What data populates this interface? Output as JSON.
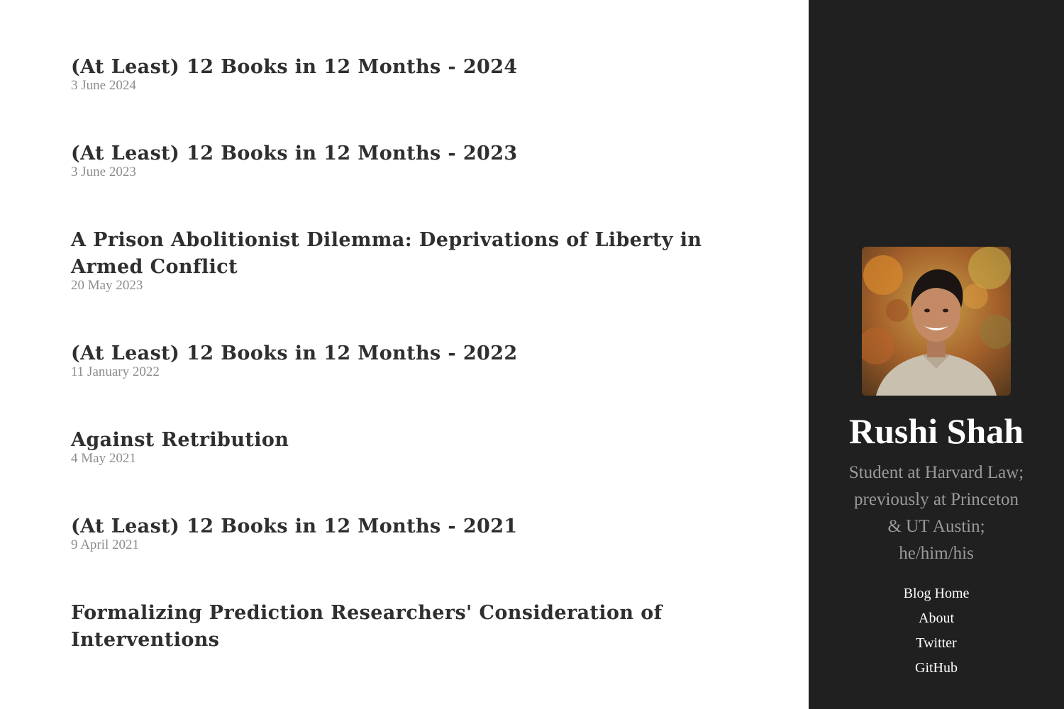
{
  "posts": [
    {
      "title": "(At Least) 12 Books in 12 Months - 2024",
      "date": "3 June 2024"
    },
    {
      "title": "(At Least) 12 Books in 12 Months - 2023",
      "date": "3 June 2023"
    },
    {
      "title": "A Prison Abolitionist Dilemma: Deprivations of Liberty in Armed Conflict",
      "date": "20 May 2023"
    },
    {
      "title": "(At Least) 12 Books in 12 Months - 2022",
      "date": "11 January 2022"
    },
    {
      "title": "Against Retribution",
      "date": "4 May 2021"
    },
    {
      "title": "(At Least) 12 Books in 12 Months - 2021",
      "date": "9 April 2021"
    },
    {
      "title": "Formalizing Prediction Researchers' Consideration of Interventions",
      "date": ""
    }
  ],
  "sidebar": {
    "name": "Rushi Shah",
    "bio_lines": [
      "Student at Harvard Law;",
      "previously at Princeton",
      "& UT Austin;",
      "he/him/his"
    ],
    "avatar_icon": "profile-photo",
    "nav": {
      "blog_home": "Blog Home",
      "about": "About",
      "twitter": "Twitter",
      "github": "GitHub"
    }
  },
  "colors": {
    "sidebar_bg": "#202020",
    "title": "#2f2f2f",
    "date": "#8c8c8c",
    "bio": "#9a9a9a"
  }
}
